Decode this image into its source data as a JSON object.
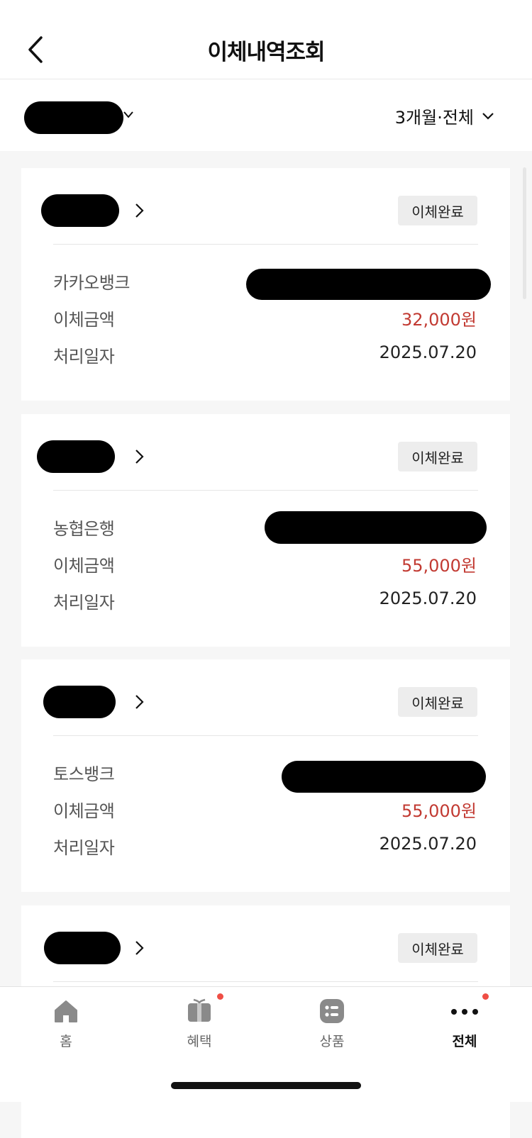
{
  "header": {
    "title": "이체내역조회"
  },
  "filter": {
    "period_label": "3개월·전체"
  },
  "cards": [
    {
      "status": "이체완료",
      "bank": "카카오뱅크",
      "amount_label": "이체금액",
      "amount": "32,000원",
      "date_label": "처리일자",
      "date": "2025.07.20"
    },
    {
      "status": "이체완료",
      "bank": "농협은행",
      "amount_label": "이체금액",
      "amount": "55,000원",
      "date_label": "처리일자",
      "date": "2025.07.20"
    },
    {
      "status": "이체완료",
      "bank": "토스뱅크",
      "amount_label": "이체금액",
      "amount": "55,000원",
      "date_label": "처리일자",
      "date": "2025.07.20"
    },
    {
      "status": "이체완료"
    }
  ],
  "nav": {
    "items": [
      {
        "label": "홈",
        "icon": "home-icon"
      },
      {
        "label": "혜택",
        "icon": "gift-icon",
        "badge": true
      },
      {
        "label": "상품",
        "icon": "products-icon"
      },
      {
        "label": "전체",
        "icon": "more-icon",
        "badge": true,
        "active": true
      }
    ]
  },
  "colors": {
    "amount": "#c23a32",
    "badge_dot": "#ef4e45",
    "background": "#f6f6f6"
  }
}
